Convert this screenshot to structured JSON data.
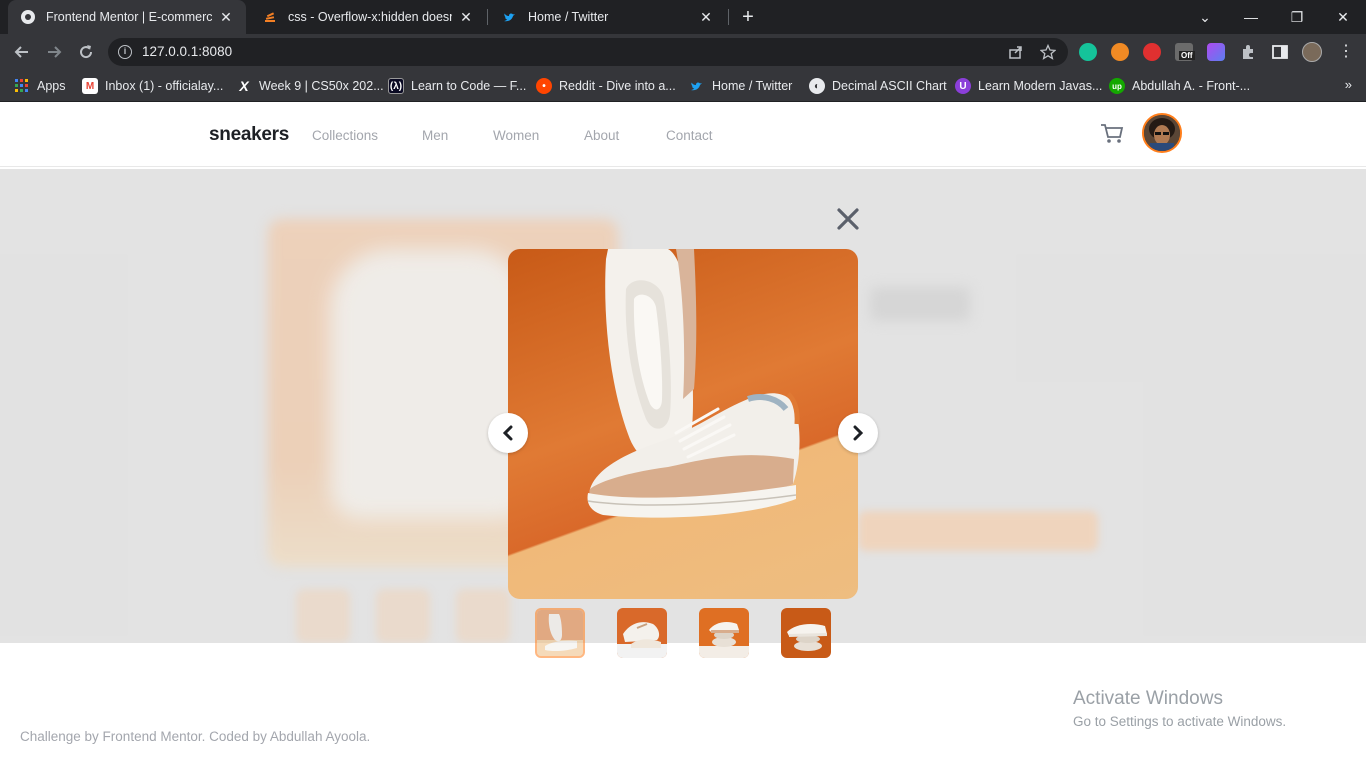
{
  "browser": {
    "tabs": [
      {
        "title": "Frontend Mentor | E-commerce p",
        "active": true
      },
      {
        "title": "css - Overflow-x:hidden doesn't p",
        "active": false
      },
      {
        "title": "Home / Twitter",
        "active": false
      }
    ],
    "url": "127.0.0.1:8080",
    "bookmarks": [
      {
        "label": "Apps"
      },
      {
        "label": "Inbox (1) - officialay..."
      },
      {
        "label": "Week 9 | CS50x 202..."
      },
      {
        "label": "Learn to Code — F..."
      },
      {
        "label": "Reddit - Dive into a..."
      },
      {
        "label": "Home / Twitter"
      },
      {
        "label": "Decimal ASCII Chart"
      },
      {
        "label": "Learn Modern Javas..."
      },
      {
        "label": "Abdullah A. - Front-..."
      }
    ],
    "extension_badge": "Off"
  },
  "site": {
    "logo": "sneakers",
    "nav": [
      "Collections",
      "Men",
      "Women",
      "About",
      "Contact"
    ]
  },
  "lightbox": {
    "thumbnail_count": 4,
    "active_thumbnail": 1
  },
  "footer": {
    "attribution": "Challenge by Frontend Mentor. Coded by Abdullah Ayoola."
  },
  "watermark": {
    "title": "Activate Windows",
    "subtitle": "Go to Settings to activate Windows."
  },
  "colors": {
    "accent": "#ff7e1b",
    "text_dark": "#1d2025",
    "text_muted": "#a3a6ad"
  }
}
